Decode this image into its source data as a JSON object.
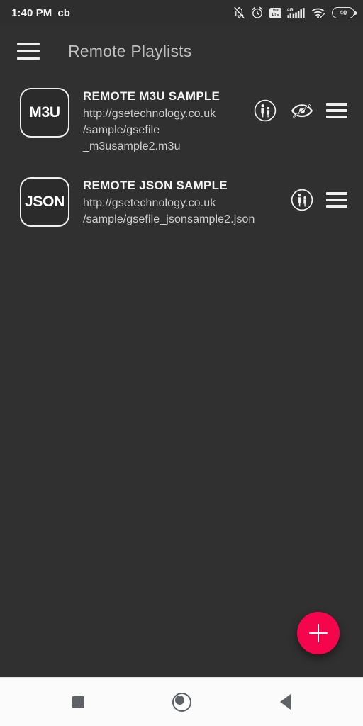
{
  "status_bar": {
    "time": "1:40 PM",
    "carrier": "cb",
    "icons": [
      "bell-muted-icon",
      "alarm-clock-icon",
      "volte-icon",
      "signal-4g-icon",
      "wifi-icon",
      "battery-icon"
    ],
    "volte_top": "VO",
    "volte_bottom": "LTE",
    "network_type": "4G",
    "battery_level": "40"
  },
  "app_bar": {
    "menu_icon": "hamburger-menu-icon",
    "title": "Remote Playlists"
  },
  "playlists": [
    {
      "badge": "M3U",
      "title": "REMOTE M3U SAMPLE",
      "url": "http://gsetechnology.co.uk\n/sample/gsefile\n_m3usample2.m3u",
      "parental_icon": "parental-control-icon",
      "visibility_icon": "eye-hidden-icon",
      "has_visibility_icon": true,
      "reorder_icon": "reorder-handle-icon"
    },
    {
      "badge": "JSON",
      "title": "REMOTE JSON SAMPLE",
      "url": "http://gsetechnology.co.uk\n/sample/gsefile_jsonsample2.json",
      "parental_icon": "parental-control-icon",
      "visibility_icon": "",
      "has_visibility_icon": false,
      "reorder_icon": "reorder-handle-icon"
    }
  ],
  "fab": {
    "icon": "plus-icon",
    "label": "+",
    "color": "#f4054c"
  },
  "nav_bar": {
    "recents_icon": "recents-square-icon",
    "home_icon": "home-circle-icon",
    "back_icon": "back-triangle-icon"
  },
  "colors": {
    "background": "#303030",
    "accent": "#f4054c",
    "text_primary": "#f4f4f4",
    "text_secondary": "#cfcfcf",
    "app_bar_title": "#bfbfbf",
    "nav_bar_background": "#fbfbfb"
  }
}
